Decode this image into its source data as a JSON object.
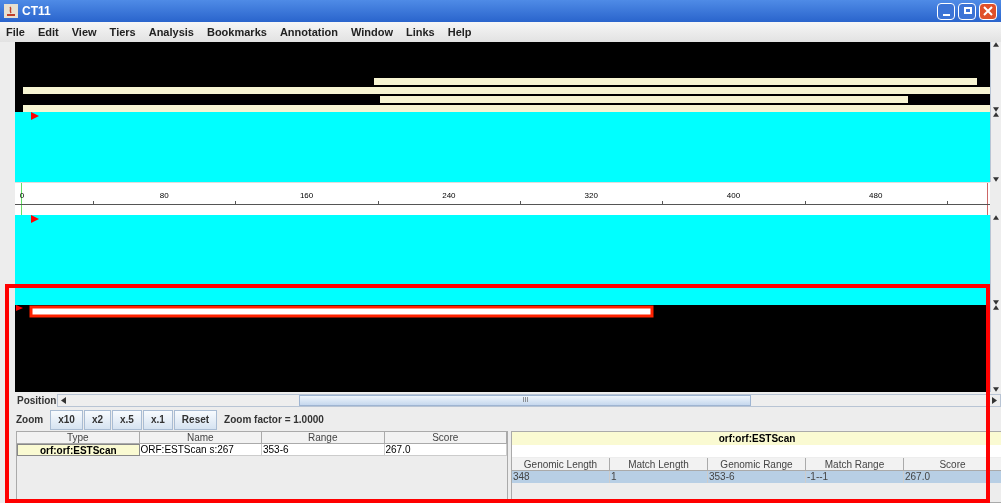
{
  "window": {
    "title": "CT11"
  },
  "menu": [
    "File",
    "Edit",
    "View",
    "Tiers",
    "Analysis",
    "Bookmarks",
    "Annotation",
    "Window",
    "Links",
    "Help"
  ],
  "ruler": {
    "labels": [
      "0",
      "80",
      "160",
      "240",
      "320",
      "400",
      "480"
    ]
  },
  "position": {
    "label": "Position",
    "scroll_grip": "III"
  },
  "zoom": {
    "label": "Zoom",
    "buttons": [
      "x10",
      "x2",
      "x.5",
      "x.1",
      "Reset"
    ],
    "factor": "Zoom factor = 1.0000"
  },
  "features_table": {
    "columns": [
      "Type",
      "Name",
      "Range",
      "Score"
    ],
    "rows": [
      {
        "selected": true,
        "cells": [
          "orf:orf:ESTScan",
          "ORF:ESTScan s:267",
          "353-6",
          "267.0"
        ]
      }
    ]
  },
  "detail": {
    "title": "orf:orf:ESTScan",
    "columns": [
      "Genomic Length",
      "Match Length",
      "Genomic Range",
      "Match Range",
      "Score"
    ],
    "rows": [
      {
        "selected": true,
        "cells": [
          "348",
          "1",
          "353-6",
          "-1--1",
          "267.0"
        ]
      }
    ]
  },
  "highlight": {
    "shown": true
  }
}
